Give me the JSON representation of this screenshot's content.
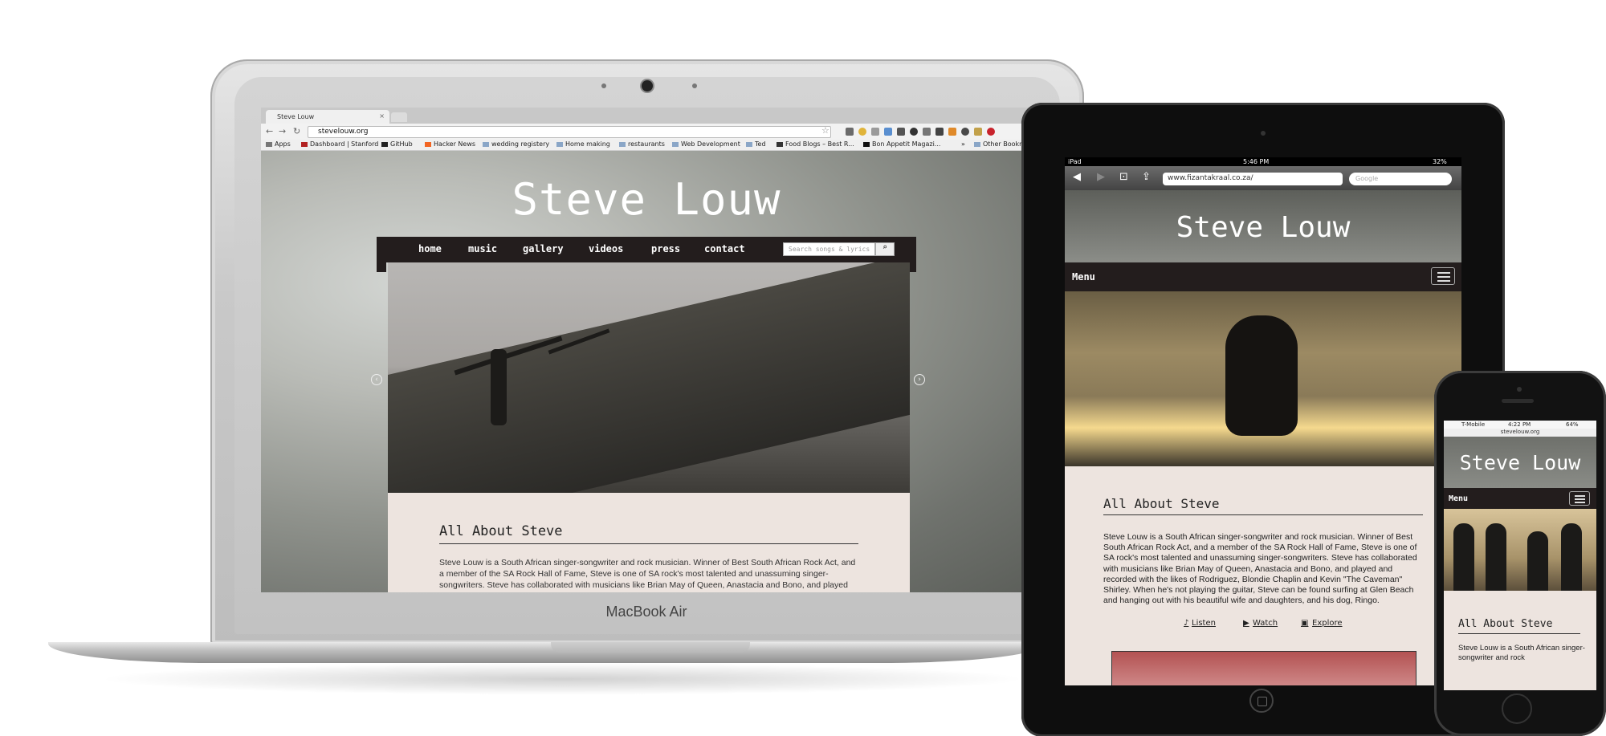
{
  "laptop": {
    "brand_label": "MacBook Air",
    "browser": {
      "tab_title": "Steve Louw",
      "tab_close": "×",
      "url": "stevelouw.org",
      "bookmarks": [
        {
          "label": "Apps"
        },
        {
          "label": "Dashboard | Stanford"
        },
        {
          "label": "GitHub"
        },
        {
          "label": "Hacker News"
        },
        {
          "label": "wedding registery"
        },
        {
          "label": "Home making"
        },
        {
          "label": "restaurants"
        },
        {
          "label": "Web Development"
        },
        {
          "label": "Ted"
        },
        {
          "label": "Food Blogs – Best R..."
        },
        {
          "label": "Bon Appetit Magazi..."
        },
        {
          "label": "»"
        },
        {
          "label": "Other Bookmarks"
        }
      ]
    },
    "site": {
      "title": "Steve Louw",
      "nav": [
        "home",
        "music",
        "gallery",
        "videos",
        "press",
        "contact"
      ],
      "search_placeholder": "Search songs & lyrics",
      "about_heading": "All About Steve",
      "about_text": "Steve Louw is a South African singer-songwriter and rock musician. Winner of Best South African Rock Act, and a member of the SA Rock Hall of Fame, Steve is one of SA rock's most talented and unassuming singer-songwriters. Steve has collaborated with musicians like Brian May of Queen, Anastacia and Bono, and played"
    }
  },
  "tablet": {
    "status": {
      "device": "iPad",
      "time": "5:46 PM",
      "battery": "32%"
    },
    "url": "www.fizantakraal.co.za/",
    "search_placeholder": "Google",
    "site": {
      "title": "Steve Louw",
      "menu_label": "Menu",
      "about_heading": "All About Steve",
      "about_text": "Steve Louw is a South African singer-songwriter and rock musician. Winner of Best South African Rock Act, and a member of the SA Rock Hall of Fame, Steve is one of SA rock's most talented and unassuming singer-songwriters. Steve has collaborated with musicians like Brian May of Queen, Anastacia and Bono, and played and recorded with the likes of Rodriguez, Blondie Chaplin and Kevin \"The Caveman\" Shirley. When he's not playing the guitar, Steve can be found surfing at Glen Beach and hanging out with his beautiful wife and daughters, and his dog, Ringo.",
      "links": [
        "Listen",
        "Watch",
        "Explore"
      ]
    }
  },
  "phone": {
    "status": {
      "carrier": "T-Mobile",
      "time": "4:22 PM",
      "battery": "64%"
    },
    "url": "stevelouw.org",
    "site": {
      "title": "Steve Louw",
      "menu_label": "Menu",
      "about_heading": "All About Steve",
      "about_text": "Steve Louw is a South African singer-songwriter and rock"
    }
  },
  "colors": {
    "nav_bg": "#231d1d",
    "content_bg": "#ede4df",
    "title_text": "#ffffff"
  }
}
